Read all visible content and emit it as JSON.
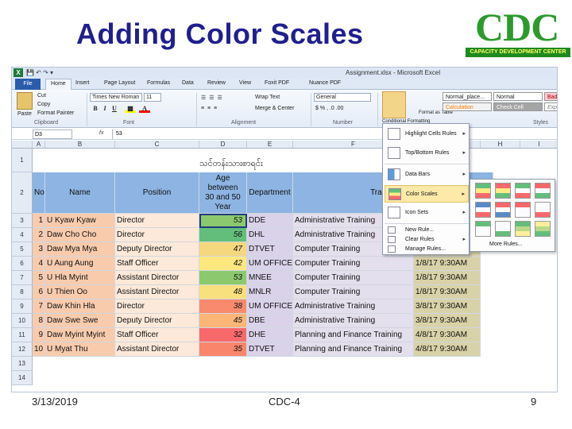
{
  "slide": {
    "title": "Adding Color Scales",
    "logo_letters": "CDC",
    "logo_band": "CAPACITY DEVELOPMENT CENTER",
    "footer_date": "3/13/2019",
    "footer_center": "CDC-4",
    "footer_page": "9"
  },
  "excel": {
    "window_title": "Assignment.xlsx - Microsoft Excel",
    "tabs": [
      "File",
      "Home",
      "Insert",
      "Page Layout",
      "Formulas",
      "Data",
      "Review",
      "View",
      "Foxit PDF",
      "Nuance PDF"
    ],
    "ribbon": {
      "paste": "Paste",
      "cut": "Cut",
      "copy": "Copy",
      "format_painter": "Format Painter",
      "clipboard": "Clipboard",
      "font_name": "Times New Roman",
      "font_size": "11",
      "font": "Font",
      "wrap_text": "Wrap Text",
      "merge_center": "Merge & Center",
      "alignment": "Alignment",
      "number_format": "General",
      "number": "Number",
      "conditional_formatting": "Conditional Formatting",
      "format_as_table": "Format as Table",
      "style_normal_place": "Normal_place...",
      "style_normal": "Normal",
      "style_bad": "Bad",
      "style_calculation": "Calculation",
      "style_check_cell": "Check Cell",
      "style_expl": "Expl",
      "styles": "Styles",
      "bold": "B",
      "italic": "I",
      "underline": "U"
    },
    "formula_bar": {
      "name_box": "D3",
      "fx": "fx",
      "value": "53"
    },
    "columns": [
      "A",
      "B",
      "C",
      "D",
      "E",
      "F",
      "G",
      "H",
      "I"
    ],
    "sheet_title": "သင်တန်းသားစာရင်း",
    "headers": {
      "no": "No",
      "name": "Name",
      "position": "Position",
      "age": [
        "Age",
        "between",
        "30 and 50",
        "Year"
      ],
      "department": "Department",
      "training": "Training Title"
    },
    "rows": [
      {
        "row": "3",
        "no": "1",
        "name": "U Kyaw Kyaw",
        "position": "Director",
        "age": "53",
        "dept": "DDE",
        "training": "Administrative Training",
        "date": ""
      },
      {
        "row": "4",
        "no": "2",
        "name": "Daw Cho Cho",
        "position": "Director",
        "age": "56",
        "dept": "DHL",
        "training": "Administrative Training",
        "date": ""
      },
      {
        "row": "5",
        "no": "3",
        "name": "Daw Mya Mya",
        "position": "Deputy Director",
        "age": "47",
        "dept": "DTVET",
        "training": "Computer Training",
        "date": "1/8/17 9:30AM"
      },
      {
        "row": "6",
        "no": "4",
        "name": "U Aung Aung",
        "position": "Staff Officer",
        "age": "42",
        "dept": "UM OFFICE-13",
        "training": "Computer Training",
        "date": "1/8/17 9:30AM"
      },
      {
        "row": "7",
        "no": "5",
        "name": "U Hla Myint",
        "position": "Assistant Director",
        "age": "53",
        "dept": "MNEE",
        "training": "Computer Training",
        "date": "1/8/17 9:30AM"
      },
      {
        "row": "8",
        "no": "6",
        "name": "U Thien Oo",
        "position": "Assistant Director",
        "age": "48",
        "dept": "MNLR",
        "training": "Computer Training",
        "date": "1/8/17 9:30AM"
      },
      {
        "row": "9",
        "no": "7",
        "name": "Daw Khin Hla",
        "position": "Director",
        "age": "38",
        "dept": "UM OFFICE-21",
        "training": "Administrative Training",
        "date": "3/8/17 9:30AM"
      },
      {
        "row": "10",
        "no": "8",
        "name": "Daw Swe Swe",
        "position": "Deputy Director",
        "age": "45",
        "dept": "DBE",
        "training": "Administrative Training",
        "date": "3/8/17 9:30AM"
      },
      {
        "row": "11",
        "no": "9",
        "name": "Daw Myint Myint",
        "position": "Staff Officer",
        "age": "32",
        "dept": "DHE",
        "training": "Planning and Finance Training",
        "date": "4/8/17 9:30AM"
      },
      {
        "row": "12",
        "no": "10",
        "name": "U Myat Thu",
        "position": "Assistant Director",
        "age": "35",
        "dept": "DTVET",
        "training": "Planning and Finance Training",
        "date": "4/8/17 9:30AM"
      }
    ],
    "age_colors": [
      "#8cc96e",
      "#63be7b",
      "#f5d77e",
      "#fde880",
      "#8cc96e",
      "#f9e07f",
      "#f98a6e",
      "#fbb677",
      "#f8696b",
      "#f8856c"
    ],
    "menu": {
      "highlight_cells": "Highlight Cells Rules",
      "top_bottom": "Top/Bottom Rules",
      "data_bars": "Data Bars",
      "color_scales": "Color Scales",
      "icon_sets": "Icon Sets",
      "new_rule": "New Rule...",
      "clear_rules": "Clear Rules",
      "manage_rules": "Manage Rules..."
    },
    "submenu": {
      "more_rules": "More Rules..."
    },
    "colors": {
      "name_fill": "#f8cbad",
      "position_fill": "#fde9d9",
      "dept_fill": "#d9d2e9",
      "training_fill": "#e4dfec",
      "date_fill": "#d9d2a8",
      "header_fill": "#8db4e2"
    }
  }
}
